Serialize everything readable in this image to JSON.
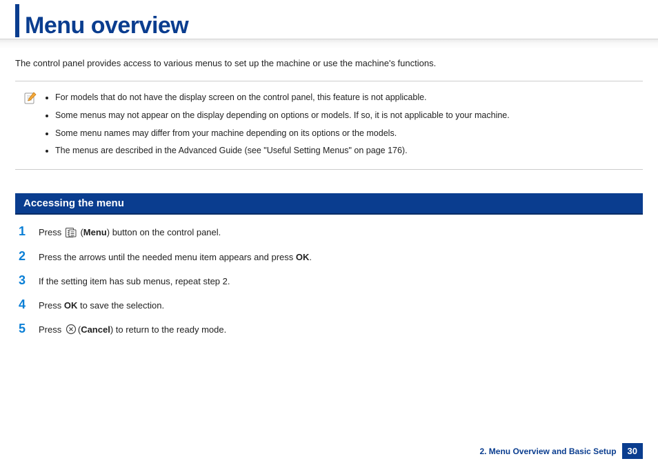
{
  "title": "Menu overview",
  "intro": "The control panel provides access to various menus to set up the machine or use the machine's functions.",
  "notes": [
    "For models that do not have the display screen on the control panel, this feature is not applicable.",
    "Some menus may not appear on the display depending on options or models. If so, it is not applicable to your machine.",
    "Some menu names may differ from your machine depending on its options or the models.",
    "The menus are described in the Advanced Guide (see \"Useful Setting Menus\" on page 176)."
  ],
  "section_header": "Accessing the menu",
  "steps": {
    "s1": {
      "num": "1",
      "p1": "Press ",
      "b1": "Menu",
      "p2": ") button on the control panel."
    },
    "s2": {
      "num": "2",
      "p1": "Press the arrows until the needed menu item appears and press ",
      "b1": "OK",
      "p2": "."
    },
    "s3": {
      "num": "3",
      "p1": "If the setting item has sub menus, repeat step 2."
    },
    "s4": {
      "num": "4",
      "p1": "Press ",
      "b1": "OK",
      "p2": " to save the selection."
    },
    "s5": {
      "num": "5",
      "p1": "Press ",
      "b1": "Cancel",
      "p2": ") to return to the ready mode."
    }
  },
  "footer": {
    "chapter": "2. Menu Overview and Basic Setup",
    "page": "30"
  }
}
